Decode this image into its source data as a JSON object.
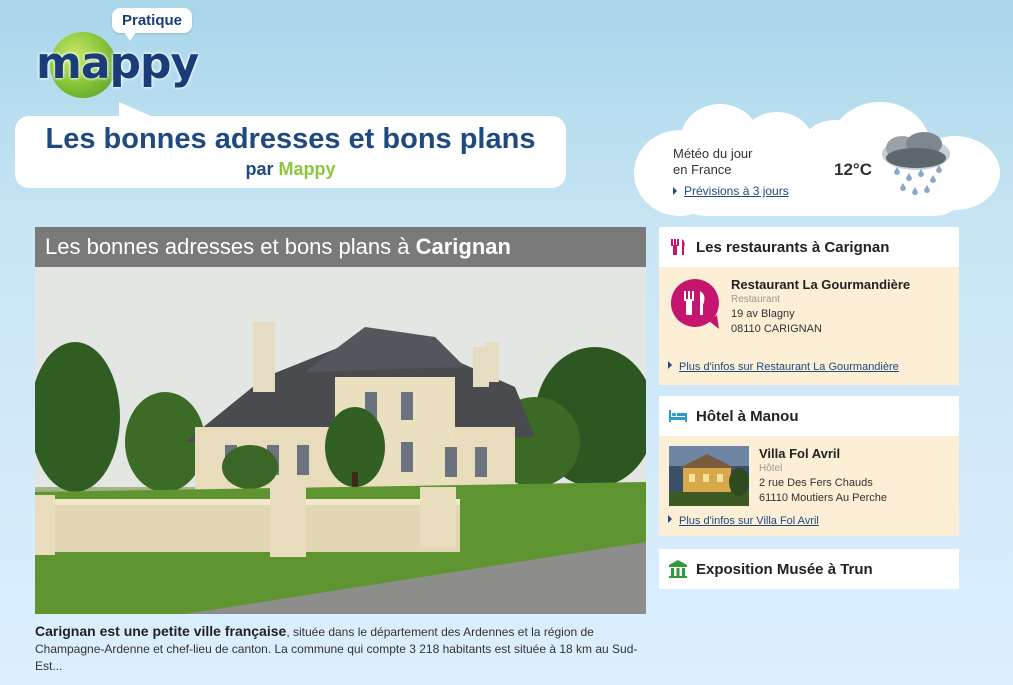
{
  "logo": {
    "brand_text": "mappy",
    "tag_label": "Pratique"
  },
  "header": {
    "title": "Les bonnes adresses et bons plans",
    "by_prefix": "par",
    "by_brand": "Mappy"
  },
  "weather": {
    "line1": "Météo du jour",
    "line2": "en France",
    "forecast_link": "Prévisions à 3 jours",
    "temperature": "12°C",
    "icon": "rain-cloud-icon"
  },
  "main": {
    "title_prefix": "Les bonnes adresses et bons plans à",
    "title_city": "Carignan",
    "photo_alt": "house-photo",
    "desc_lead": "Carignan est une petite ville française",
    "desc_text": ", située dans le département des Ardennes et la région de Champagne-Ardenne et chef-lieu de canton. La commune qui compte 3 218 habitants est située à 18 km au Sud-Est..."
  },
  "restaurants": {
    "title": "Les restaurants à Carignan",
    "icon": "fork-knife-icon",
    "accent": "#c4166e",
    "item": {
      "name": "Restaurant La Gourmandière",
      "type": "Restaurant",
      "address1": "19 av Blagny",
      "address2": "08110 CARIGNAN"
    },
    "more_link": "Plus d'infos sur Restaurant La Gourmandière"
  },
  "hotel": {
    "title": "Hôtel à Manou",
    "icon": "bed-icon",
    "accent": "#2a9ad4",
    "item": {
      "name": "Villa Fol Avril",
      "type": "Hôtel",
      "address1": "2 rue Des Fers Chauds",
      "address2": "61110 Moutiers Au Perche"
    },
    "more_link": "Plus d'infos sur Villa Fol Avril"
  },
  "exposition": {
    "title": "Exposition Musée à Trun",
    "icon": "museum-columns-icon",
    "accent": "#2f9a3c"
  }
}
